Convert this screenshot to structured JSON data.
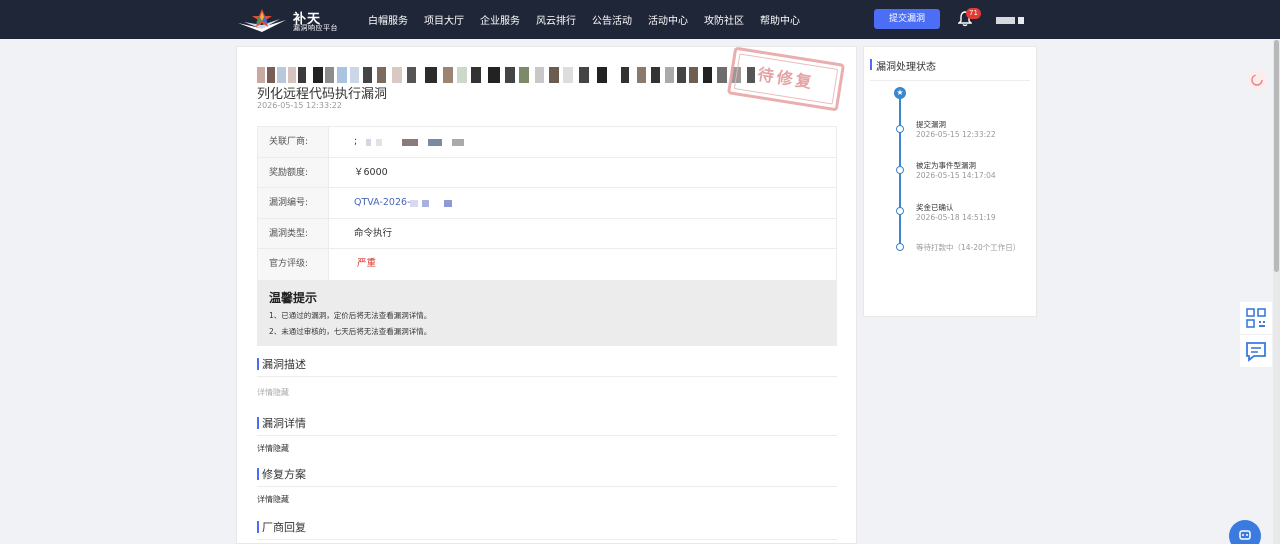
{
  "brand": {
    "name": "补天",
    "subtitle": "漏洞响应平台"
  },
  "nav": {
    "items": [
      "白帽服务",
      "项目大厅",
      "企业服务",
      "风云排行",
      "公告活动",
      "活动中心",
      "攻防社区",
      "帮助中心"
    ],
    "submit_label": "提交漏洞",
    "notification_count": "71"
  },
  "vuln": {
    "title_visible": "列化远程代码执行漏洞",
    "date": "2026-05-15 12:33:22",
    "stamp": "待修复"
  },
  "info": {
    "vendor_label": "关联厂商:",
    "vendor_prefix": ";",
    "reward_label": "奖励额度:",
    "reward_value": "￥6000",
    "id_label": "漏洞编号:",
    "id_value": "QTVA-2026-",
    "type_label": "漏洞类型:",
    "type_value": "命令执行",
    "rating_label": "官方评级:",
    "rating_value": "严重"
  },
  "tips": {
    "title": "温馨提示",
    "line1": "1、已通过的漏洞，定价后将无法查看漏洞详情。",
    "line2": "2、未通过审核的，七天后将无法查看漏洞详情。"
  },
  "sections": {
    "desc_title": "漏洞描述",
    "desc_body": "详情隐藏",
    "detail_title": "漏洞详情",
    "detail_body": "详情隐藏",
    "fix_title": "修复方案",
    "fix_body": "详情隐藏",
    "reply_title": "厂商回复"
  },
  "status": {
    "title": "漏洞处理状态",
    "steps": [
      {
        "title": "提交漏洞",
        "time": "2026-05-15 12:33:22"
      },
      {
        "title": "被定为事件型漏洞",
        "time": "2026-05-15 14:17:04"
      },
      {
        "title": "奖金已确认",
        "time": "2026-05-18 14:51:19"
      },
      {
        "title": "等待打款中（14-20个工作日）",
        "time": ""
      }
    ]
  },
  "colors": {
    "nav_bg": "#1f2638",
    "accent": "#4b6ef5",
    "danger": "#d9362b",
    "link": "#4a66b8",
    "timeline": "#3c86c9"
  }
}
